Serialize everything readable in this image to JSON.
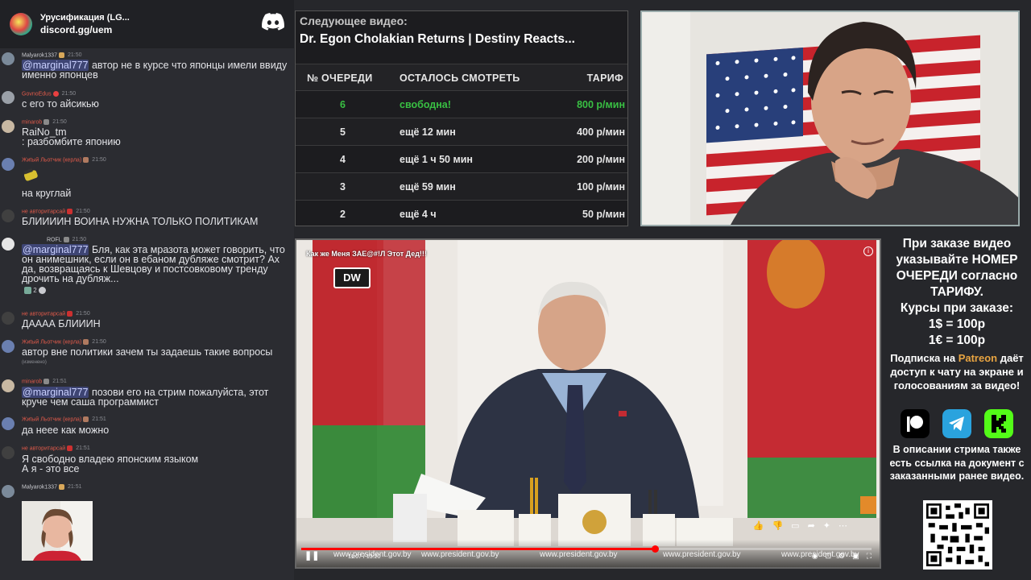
{
  "chat": {
    "server_invite_title": "Урусификация (LG...",
    "server_invite_url": "discord.gg/uem",
    "messages": [
      {
        "user": "Malyarok1337",
        "user_color": "#c9cacf",
        "time": "21:50",
        "lines": [
          "@marginal777",
          " автор не в курсе что японцы имели ввиду именно японцев"
        ]
      },
      {
        "user": "GovnoEdus",
        "user_color": "#e05a4a",
        "time": "21:50",
        "lines": [
          "с его то айсикью"
        ]
      },
      {
        "user": "minarob",
        "user_color": "#e05a4a",
        "time": "21:50",
        "lines": [
          "RaiNo_tm",
          ": разбомбите японию"
        ]
      },
      {
        "user": "Жиtый Льотчик (керла)",
        "user_color": "#e05a4a",
        "time": "21:50",
        "lines": [
          "на  круглай"
        ]
      },
      {
        "user": "не авторитарсай",
        "user_color": "#e05a4a",
        "time": "21:50",
        "lines": [
          "БЛИИИИН ВОИНА НУЖНА ТОЛЬКО ПОЛИТИКАМ"
        ]
      },
      {
        "user": "ROFL",
        "user_color": "#c9cacf",
        "time": "21:50",
        "lines": [
          "@marginal777",
          " Бля, как эта мразота может говорить, что он анимешник, если он в ебаном дубляже смотрит? Ах да, возвращаясь к Шевцову и постсовковому тренду дрочить на дубляж..."
        ],
        "reactions": "2"
      },
      {
        "user": "не авторитарсай",
        "user_color": "#e05a4a",
        "time": "21:50",
        "lines": [
          "ДАААА БЛИИИН"
        ]
      },
      {
        "user": "Жиtый Льотчик (керла)",
        "user_color": "#e05a4a",
        "time": "21:50",
        "lines": [
          "автор вне политики зачем ты задаешь такие вопросы"
        ],
        "note": "(изменено)"
      },
      {
        "user": "minarob",
        "user_color": "#e05a4a",
        "time": "21:51",
        "lines": [
          "@marginal777",
          " позови его на стрим пожалуйста, этот круче чем саша программист"
        ]
      },
      {
        "user": "Жиtый Льотчик (керла)",
        "user_color": "#e05a4a",
        "time": "21:51",
        "lines": [
          "да неее как можно"
        ]
      },
      {
        "user": "не авторитарсай",
        "user_color": "#e05a4a",
        "time": "21:51",
        "lines": [
          "Я свободно владею японским языком",
          "А я - это все"
        ]
      },
      {
        "user": "Malyarok1337",
        "user_color": "#c9cacf",
        "time": "21:51",
        "lines": []
      }
    ]
  },
  "queue": {
    "next_label": "Следующее видео:",
    "next_title": "Dr. Egon Cholakian Returns | Destiny Reacts...",
    "headers": [
      "№ ОЧЕРЕДИ",
      "ОСТАЛОСЬ СМОТРЕТЬ",
      "ТАРИФ"
    ],
    "rows": [
      {
        "num": "6",
        "remaining": "свободна!",
        "price": "800 р/мин",
        "free": true
      },
      {
        "num": "5",
        "remaining": "ещё 12 мин",
        "price": "400 р/мин",
        "free": false
      },
      {
        "num": "4",
        "remaining": "ещё 1 ч 50 мин",
        "price": "200 р/мин",
        "free": false
      },
      {
        "num": "3",
        "remaining": "ещё 59 мин",
        "price": "100 р/мин",
        "free": false
      },
      {
        "num": "2",
        "remaining": "ещё 4 ч",
        "price": "50 р/мин",
        "free": false
      }
    ]
  },
  "player": {
    "video_title": "Как же Меня ЗАЕ@#!Л Этот Дед!!!",
    "channel_logo": "DW",
    "time": "11:07 / 13:20",
    "progress": 0.62,
    "watermark": "www.president.gov.by"
  },
  "info": {
    "order_note": "При заказе видео указывайте НОМЕР ОЧЕРЕДИ согласно ТАРИФУ.",
    "rates_label": "Курсы при заказе:",
    "rate_usd": "1$ = 100р",
    "rate_eur": "1€ = 100р",
    "sub_prefix": "Подписка на ",
    "sub_brand": "Patreon",
    "sub_suffix": " даёт доступ к чату на экране и голосованиям за видео!",
    "description_note": "В описании стрима также есть ссылка на документ с заказанными ранее видео."
  },
  "colors": {
    "free": "#39c043",
    "patreon": "#e8a441",
    "telegram": "#2aa3de",
    "kick": "#53fc18"
  }
}
